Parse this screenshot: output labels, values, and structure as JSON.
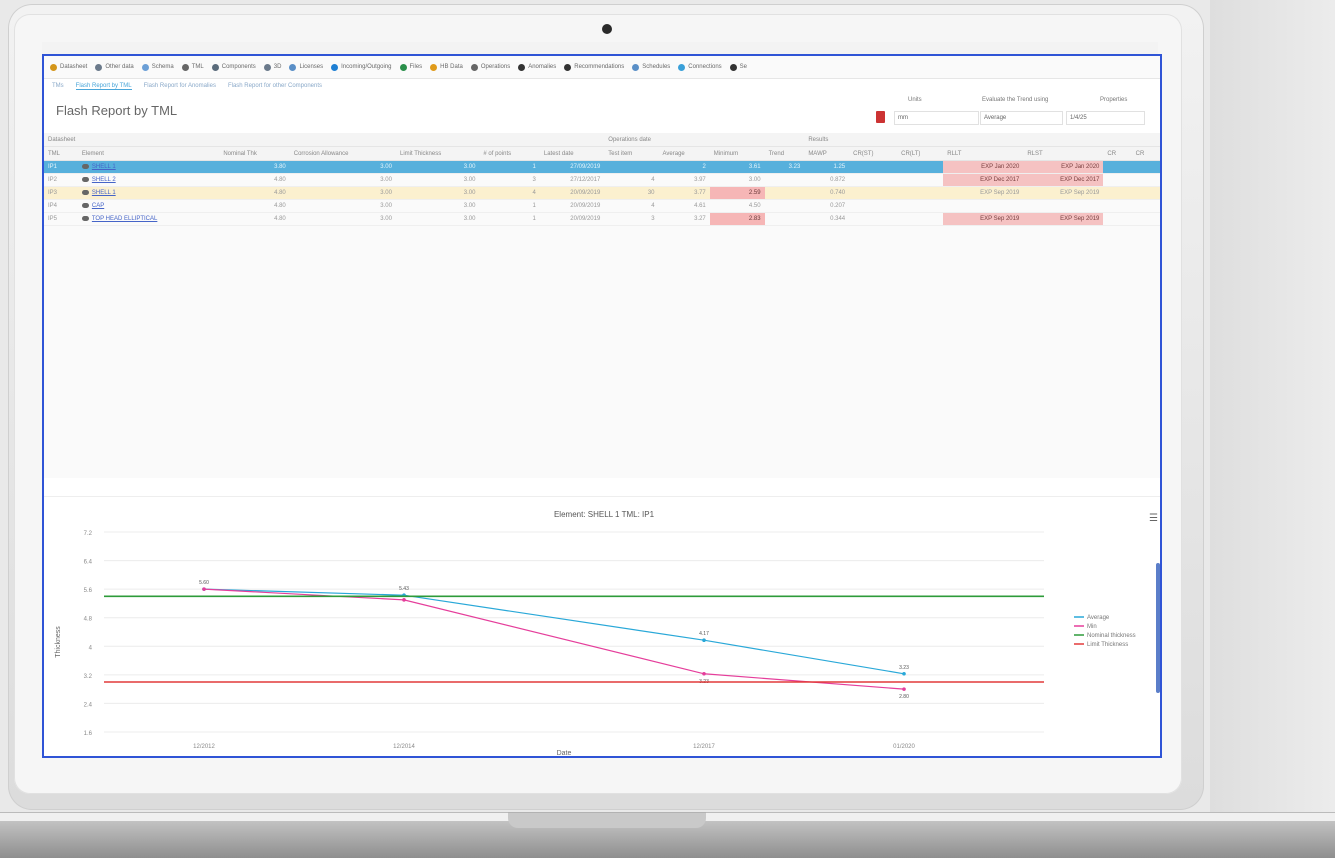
{
  "menu": [
    "Datasheet",
    "Other data",
    "Schema",
    "TML",
    "Components",
    "3D",
    "Licenses",
    "Incoming/Outgoing",
    "Files",
    "HB Data",
    "Operations",
    "Anomalies",
    "Recommendations",
    "Schedules",
    "Connections",
    "Se"
  ],
  "subnav": {
    "items": [
      "TMs",
      "Flash Report by TML",
      "Flash Report for Anomalies",
      "Flash Report for other Components"
    ],
    "active_index": 1
  },
  "page_title": "Flash Report by TML",
  "controls": {
    "units_label": "Units",
    "units_value": "mm",
    "evaluate_label": "Evaluate the Trend using",
    "evaluate_value": "Average",
    "properties_label": "Properties",
    "properties_value": "1/4/25"
  },
  "table": {
    "groups": [
      "Datasheet",
      "Operations date",
      "Results"
    ],
    "columns": [
      "TML",
      "Element",
      "Nominal Thk",
      "Corrosion Allowance",
      "Limit Thickness",
      "# of points",
      "Latest date",
      "Test item",
      "Average",
      "Minimum",
      "Trend",
      "MAWP",
      "CR(ST)",
      "CR(LT)",
      "RLLT",
      "RLST",
      "CR",
      "CR"
    ],
    "rows": [
      {
        "tml": "IP1",
        "element": "SHELL 1",
        "vals": [
          "3.80",
          "3.00",
          "3.00",
          "1",
          "27/09/2019",
          "",
          "2",
          "3.61",
          "3.23",
          "1.25"
        ],
        "e1": "EXP Jan 2020",
        "e2": "EXP Jan 2020",
        "state": "selected"
      },
      {
        "tml": "IP2",
        "element": "SHELL 2",
        "vals": [
          "4.80",
          "3.00",
          "3.00",
          "3",
          "27/12/2017",
          "4",
          "3.97",
          "3.00",
          "",
          "0.872"
        ],
        "e1": "EXP Dec 2017",
        "e2": "EXP Dec 2017",
        "state": "normal"
      },
      {
        "tml": "IP3",
        "element": "SHELL 1",
        "vals": [
          "4.80",
          "3.00",
          "3.00",
          "4",
          "20/09/2019",
          "30",
          "3.77",
          "2.59",
          "",
          "0.740"
        ],
        "e1": "EXP Sep 2019",
        "e2": "EXP Sep 2019",
        "state": "warn"
      },
      {
        "tml": "IP4",
        "element": "CAP",
        "vals": [
          "4.80",
          "3.00",
          "3.00",
          "1",
          "20/09/2019",
          "4",
          "4.61",
          "4.50",
          "",
          "0.207"
        ],
        "e1": "",
        "e2": "",
        "state": "normal"
      },
      {
        "tml": "IP5",
        "element": "TOP HEAD ELLIPTICAL",
        "vals": [
          "4.80",
          "3.00",
          "3.00",
          "1",
          "20/09/2019",
          "3",
          "3.27",
          "2.83",
          "",
          "0.344"
        ],
        "e1": "EXP Sep 2019",
        "e2": "EXP Sep 2019",
        "state": "normal"
      }
    ]
  },
  "chart_data": {
    "type": "line",
    "title": "Element: SHELL 1 TML: IP1",
    "xlabel": "Date",
    "ylabel": "Thickness",
    "categories": [
      "12/2012",
      "12/2014",
      "12/2017",
      "01/2020"
    ],
    "x_positions": [
      2013.0,
      2015.0,
      2018.0,
      2020.0
    ],
    "ylim": [
      1.6,
      7.2
    ],
    "yticks": [
      "7.2",
      "6.4",
      "5.6",
      "4.8",
      "4",
      "3.2",
      "2.4",
      "1.6"
    ],
    "series": [
      {
        "name": "Average",
        "color": "#29a8d8",
        "values": [
          5.6,
          5.43,
          4.17,
          3.23
        ],
        "labels": [
          "5.60",
          "5.43",
          "4.17",
          "3.23"
        ]
      },
      {
        "name": "Min",
        "color": "#e53e9b",
        "values": [
          5.6,
          5.3,
          3.23,
          2.8
        ],
        "labels": [
          "",
          "",
          "3.23",
          "2.80"
        ]
      },
      {
        "name": "Nominal thickness",
        "color": "#2e9b3a",
        "values": [
          5.4,
          5.4,
          5.4,
          5.4
        ],
        "labels": []
      },
      {
        "name": "Limit Thickness",
        "color": "#e23a3a",
        "values": [
          3.0,
          3.0,
          3.0,
          3.0
        ],
        "labels": []
      }
    ],
    "legend_position": "right",
    "grid": true
  }
}
